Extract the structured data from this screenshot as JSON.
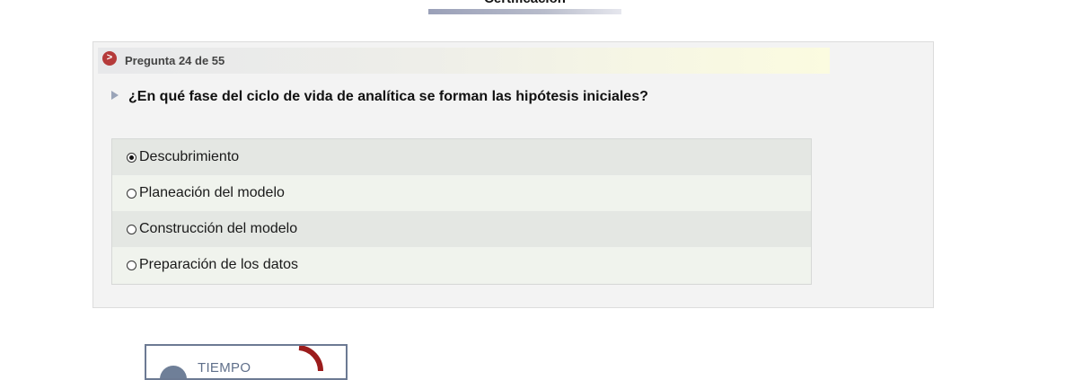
{
  "header": {
    "title": "Certificación"
  },
  "question": {
    "counter": "Pregunta 24 de 55",
    "prompt": "¿En qué fase del ciclo de vida de analítica se forman las hipótesis iniciales?",
    "options": [
      {
        "label": "Descubrimiento",
        "selected": true
      },
      {
        "label": "Planeación del modelo",
        "selected": false
      },
      {
        "label": "Construcción del modelo",
        "selected": false
      },
      {
        "label": "Preparación de los datos",
        "selected": false
      }
    ]
  },
  "timer": {
    "label": "TIEMPO"
  },
  "colors": {
    "accent": "#b53a3a",
    "timer": "#6f7f98",
    "ring": "#9b1c1c"
  }
}
